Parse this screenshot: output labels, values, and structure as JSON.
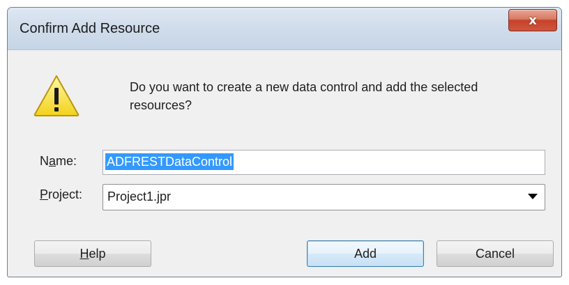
{
  "window": {
    "title": "Confirm Add Resource",
    "close_glyph": "x"
  },
  "dialog": {
    "icon": "warning-icon",
    "message": "Do you want to create a new data control and add the selected resources?"
  },
  "form": {
    "name_label_pre": "N",
    "name_label_mnemonic": "a",
    "name_label_post": "me:",
    "name_value": "ADFRESTDataControl",
    "project_label_mnemonic": "P",
    "project_label_post": "roject:",
    "project_value": "Project1.jpr"
  },
  "buttons": {
    "help_mnemonic": "H",
    "help_rest": "elp",
    "add": "Add",
    "cancel": "Cancel"
  },
  "colors": {
    "selection": "#3399ff",
    "close_button": "#c64229",
    "default_button_border": "#3c7fb1"
  }
}
